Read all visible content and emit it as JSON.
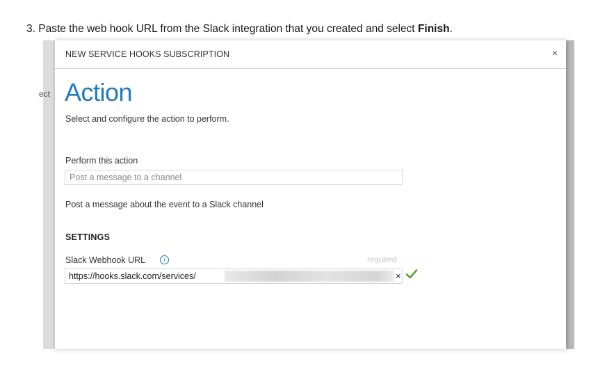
{
  "instruction": {
    "number": "3.",
    "text_before": " Paste the web hook URL from the Slack integration that you created and select ",
    "bold": "Finish",
    "text_after": "."
  },
  "backdrop": {
    "partial_text": "ect"
  },
  "dialog": {
    "title": "NEW SERVICE HOOKS SUBSCRIPTION",
    "close_glyph": "×",
    "heading": "Action",
    "subtitle": "Select and configure the action to perform.",
    "perform_label": "Perform this action",
    "perform_value": "Post a message to a channel",
    "action_description": "Post a message about the event to a Slack channel",
    "settings_heading": "SETTINGS",
    "webhook": {
      "label": "Slack Webhook URL",
      "info_glyph": "i",
      "required_label": "required",
      "value": "https://hooks.slack.com/services/",
      "clear_glyph": "×",
      "valid_icon": "checkmark-icon",
      "valid_color": "#5aa52b"
    },
    "accent_color": "#1e7bc1"
  }
}
